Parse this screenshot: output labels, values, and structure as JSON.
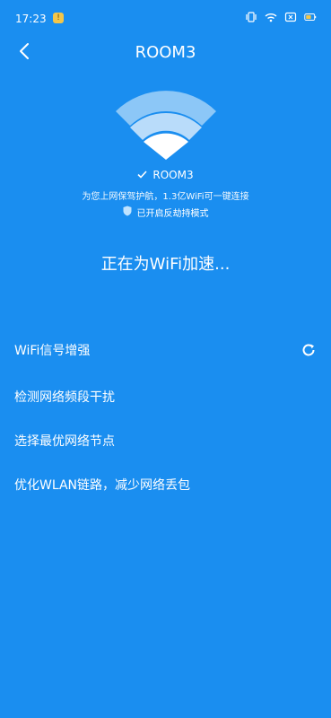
{
  "status_bar": {
    "time": "17:23",
    "notification_badge": "!",
    "icons": [
      "vibrate-icon",
      "wifi-signal-icon",
      "screen-record-icon",
      "battery-icon"
    ]
  },
  "nav": {
    "back_icon": "chevron-left-icon",
    "title": "ROOM3"
  },
  "network": {
    "ssid": "ROOM3",
    "subtitle": "为您上网保驾护航，1.3亿WiFi可一键连接",
    "protection": "已开启反劫持模式"
  },
  "status_text": "正在为WiFi加速...",
  "tasks": [
    {
      "label": "WiFi信号增强",
      "state": "loading"
    },
    {
      "label": "检测网络频段干扰",
      "state": "pending"
    },
    {
      "label": "选择最优网络节点",
      "state": "pending"
    },
    {
      "label": "优化WLAN链路，减少网络丢包",
      "state": "pending"
    }
  ],
  "colors": {
    "background": "#1a8ef0",
    "text": "#ffffff",
    "wifi_outer": "#8cc7f7",
    "wifi_inner": "#ffffff"
  }
}
